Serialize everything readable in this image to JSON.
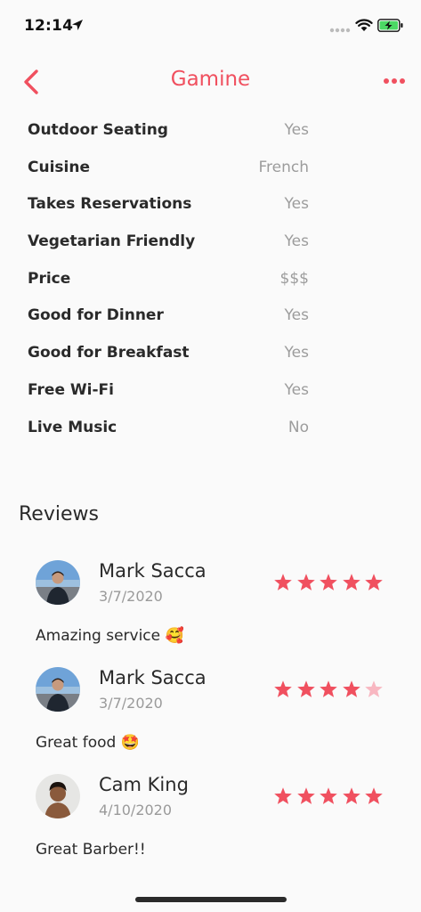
{
  "status_bar": {
    "time": "12:14"
  },
  "nav": {
    "title": "Gamine",
    "back_icon": "chevron-left-icon",
    "more_icon": "ellipsis-icon",
    "accent": "#f0505f"
  },
  "attributes": [
    {
      "label": "Outdoor Seating",
      "value": "Yes"
    },
    {
      "label": "Cuisine",
      "value": "French"
    },
    {
      "label": "Takes Reservations",
      "value": "Yes"
    },
    {
      "label": "Vegetarian Friendly",
      "value": "Yes"
    },
    {
      "label": "Price",
      "value": "$$$"
    },
    {
      "label": "Good for Dinner",
      "value": "Yes"
    },
    {
      "label": "Good for Breakfast",
      "value": "Yes"
    },
    {
      "label": "Free Wi-Fi",
      "value": "Yes"
    },
    {
      "label": "Live Music",
      "value": "No"
    }
  ],
  "reviews_heading": "Reviews",
  "reviews": [
    {
      "name": "Mark Sacca",
      "date": "3/7/2020",
      "rating": 5,
      "text": "Amazing service 🥰"
    },
    {
      "name": "Mark Sacca",
      "date": "3/7/2020",
      "rating": 4,
      "text": "Great food 🤩"
    },
    {
      "name": "Cam King",
      "date": "4/10/2020",
      "rating": 5,
      "text": "Great Barber!!"
    }
  ],
  "colors": {
    "star_full": "#f0505f",
    "star_empty": "#f8b7c1"
  }
}
